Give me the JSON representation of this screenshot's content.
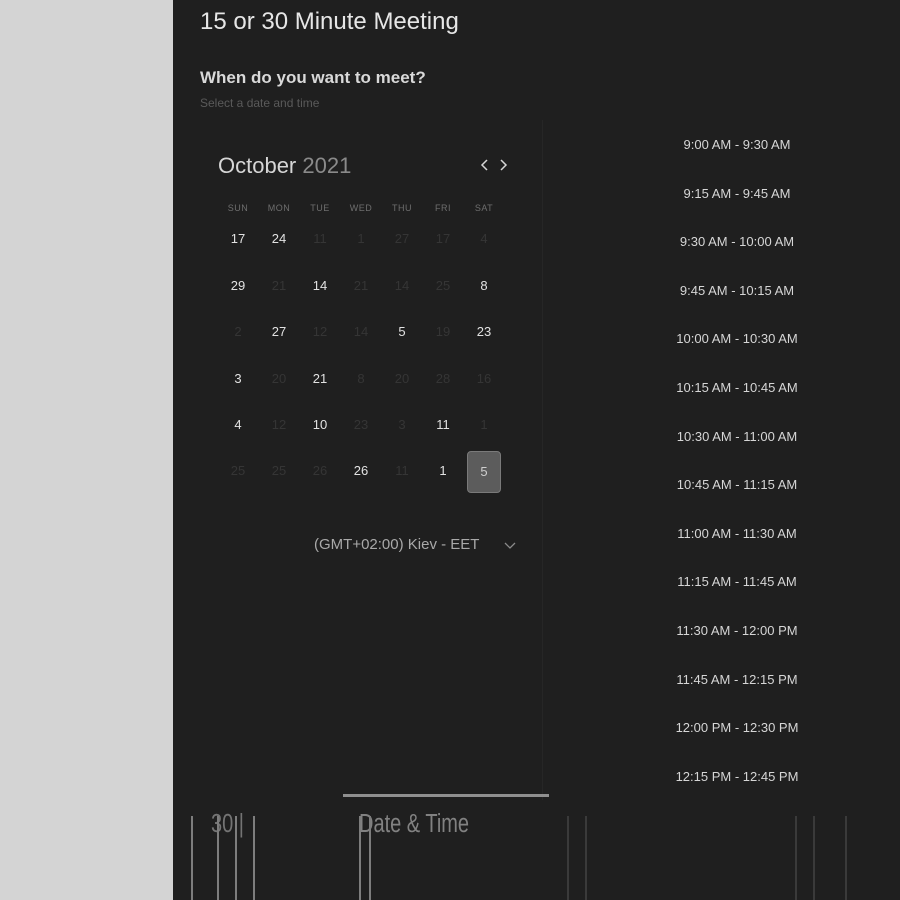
{
  "header": {
    "title": "15 or 30 Minute Meeting",
    "question": "When do you want to meet?",
    "subtitle": "Select a date and time"
  },
  "calendar": {
    "month": "October",
    "year": "2021",
    "prev_icon": "chevron-left-icon",
    "next_icon": "chevron-right-icon",
    "weekdays": [
      "SUN",
      "MON",
      "TUE",
      "WED",
      "THU",
      "FRI",
      "SAT"
    ],
    "weeks": [
      [
        {
          "label": "17",
          "state": "available"
        },
        {
          "label": "24",
          "state": "available"
        },
        {
          "label": "11",
          "state": "unavailable"
        },
        {
          "label": "1",
          "state": "unavailable"
        },
        {
          "label": "27",
          "state": "unavailable"
        },
        {
          "label": "17",
          "state": "unavailable"
        },
        {
          "label": "4",
          "state": "unavailable"
        }
      ],
      [
        {
          "label": "29",
          "state": "available"
        },
        {
          "label": "21",
          "state": "unavailable"
        },
        {
          "label": "14",
          "state": "available"
        },
        {
          "label": "21",
          "state": "unavailable"
        },
        {
          "label": "14",
          "state": "unavailable"
        },
        {
          "label": "25",
          "state": "unavailable"
        },
        {
          "label": "8",
          "state": "available"
        }
      ],
      [
        {
          "label": "2",
          "state": "unavailable"
        },
        {
          "label": "27",
          "state": "available"
        },
        {
          "label": "12",
          "state": "unavailable"
        },
        {
          "label": "14",
          "state": "unavailable"
        },
        {
          "label": "5",
          "state": "available"
        },
        {
          "label": "19",
          "state": "unavailable"
        },
        {
          "label": "23",
          "state": "available"
        }
      ],
      [
        {
          "label": "3",
          "state": "available"
        },
        {
          "label": "20",
          "state": "unavailable"
        },
        {
          "label": "21",
          "state": "available"
        },
        {
          "label": "8",
          "state": "unavailable"
        },
        {
          "label": "20",
          "state": "unavailable"
        },
        {
          "label": "28",
          "state": "unavailable"
        },
        {
          "label": "16",
          "state": "unavailable"
        }
      ],
      [
        {
          "label": "4",
          "state": "available"
        },
        {
          "label": "12",
          "state": "unavailable"
        },
        {
          "label": "10",
          "state": "available"
        },
        {
          "label": "23",
          "state": "unavailable"
        },
        {
          "label": "3",
          "state": "unavailable"
        },
        {
          "label": "11",
          "state": "available"
        },
        {
          "label": "1",
          "state": "unavailable"
        }
      ],
      [
        {
          "label": "25",
          "state": "unavailable"
        },
        {
          "label": "25",
          "state": "unavailable"
        },
        {
          "label": "26",
          "state": "unavailable"
        },
        {
          "label": "26",
          "state": "available"
        },
        {
          "label": "11",
          "state": "unavailable"
        },
        {
          "label": "1",
          "state": "available"
        },
        {
          "label": "5",
          "state": "selected"
        }
      ]
    ]
  },
  "timezone": {
    "label": "(GMT+02:00) Kiev - EET",
    "icon": "chevron-down-icon"
  },
  "time_slots": [
    "9:00 AM - 9:30 AM",
    "9:15 AM - 9:45 AM",
    "9:30 AM - 10:00 AM",
    "9:45 AM - 10:15 AM",
    "10:00 AM - 10:30 AM",
    "10:15 AM - 10:45 AM",
    "10:30 AM - 11:00 AM",
    "10:45 AM - 11:15 AM",
    "11:00 AM - 11:30 AM",
    "11:15 AM - 11:45 AM",
    "11:30 AM - 12:00 PM",
    "11:45 AM - 12:15 PM",
    "12:00 PM - 12:30 PM",
    "12:15 PM - 12:45 PM"
  ],
  "footer": {
    "text_a": "30 |",
    "text_b": "Date & Time"
  },
  "colors": {
    "background": "#1f1f1f",
    "gutter": "#d4d4d4",
    "selected_day": "#5c5c5c",
    "text_primary": "#e2e2e2",
    "text_muted": "#353535"
  }
}
